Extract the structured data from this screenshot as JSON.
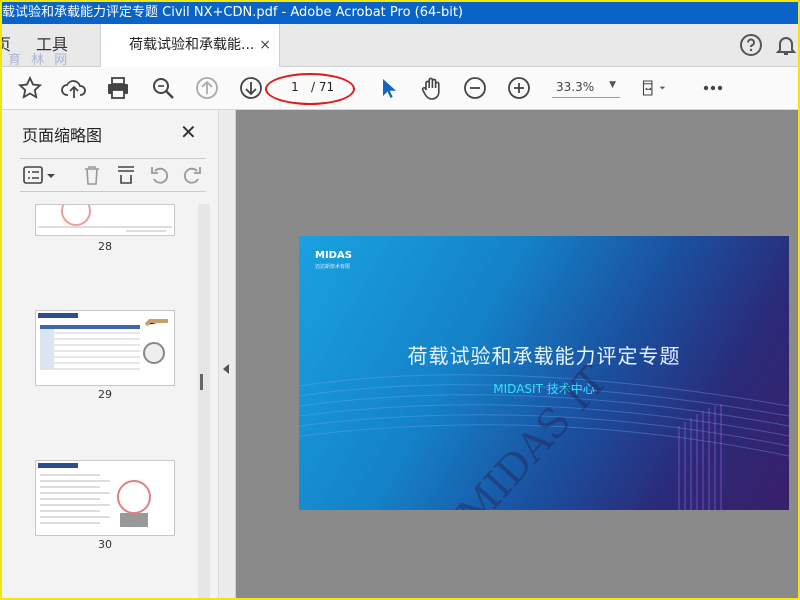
{
  "window": {
    "title": "载试验和承载能力评定专题 Civil NX+CDN.pdf - Adobe Acrobat Pro (64-bit)"
  },
  "tabs": {
    "home_partial": "页",
    "tools": "工具",
    "doc": "荷载试验和承载能...",
    "close": "×"
  },
  "site_watermark": "育 林 网",
  "toolbar": {
    "page_current": "1",
    "page_total": "/ 71",
    "zoom": "33.3%"
  },
  "thumbnail_panel": {
    "title": "页面缩略图",
    "close": "✕",
    "pages": [
      {
        "number": "28"
      },
      {
        "number": "29"
      },
      {
        "number": "30"
      }
    ]
  },
  "slide": {
    "logo": "MIDAS",
    "logo_sub": "迈达斯技术有限",
    "title": "荷载试验和承载能力评定专题",
    "subtitle": "MIDASIT 技术中心",
    "watermark": "MIDAS IT"
  },
  "colors": {
    "titlebar": "#0a64c8",
    "annotation": "#e01a1a",
    "border": "#f5e60a"
  }
}
